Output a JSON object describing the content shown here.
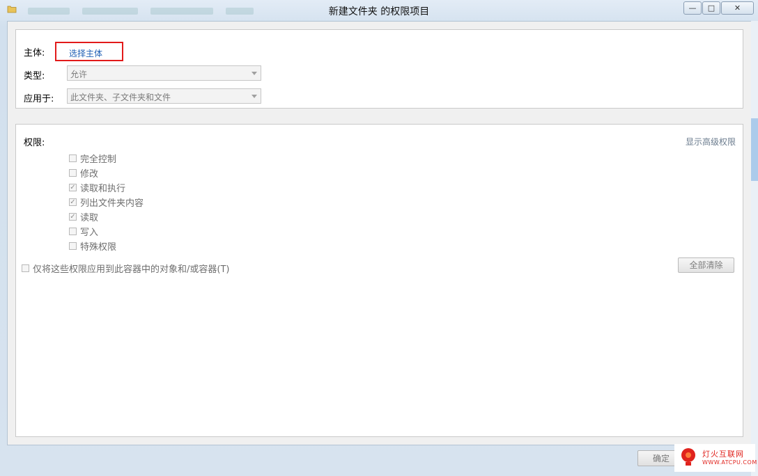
{
  "window": {
    "title": "新建文件夹 的权限项目",
    "controls": {
      "minimize": "—",
      "maximize": "□",
      "close": "✕"
    }
  },
  "principal": {
    "label": "主体:",
    "link": "选择主体"
  },
  "type": {
    "label": "类型:",
    "value": "允许"
  },
  "applies_to": {
    "label": "应用于:",
    "value": "此文件夹、子文件夹和文件"
  },
  "permissions": {
    "label": "权限:",
    "advanced_link": "显示高级权限",
    "items": [
      {
        "label": "完全控制",
        "checked": false
      },
      {
        "label": "修改",
        "checked": false
      },
      {
        "label": "读取和执行",
        "checked": true
      },
      {
        "label": "列出文件夹内容",
        "checked": true
      },
      {
        "label": "读取",
        "checked": true
      },
      {
        "label": "写入",
        "checked": false
      },
      {
        "label": "特殊权限",
        "checked": false
      }
    ],
    "apply_only_label": "仅将这些权限应用到此容器中的对象和/或容器(T)",
    "clear_all": "全部清除"
  },
  "footer": {
    "ok_label": "确定"
  },
  "watermark": {
    "title": "灯火互联网",
    "url": "WWW.ATCPU.COM"
  },
  "icons": {
    "app": "folder-icon",
    "check": "checkmark-icon",
    "dropdown": "chevron-down-icon"
  }
}
